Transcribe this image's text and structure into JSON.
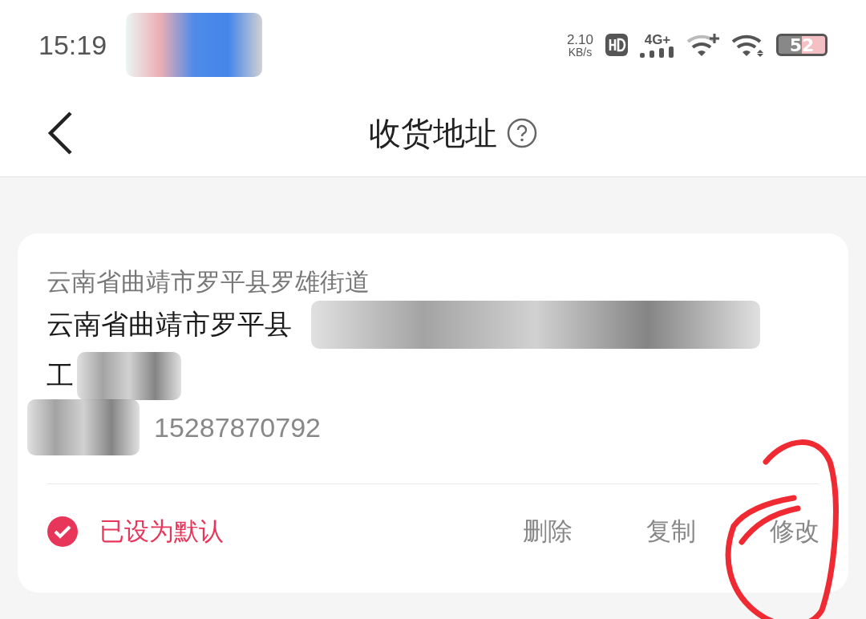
{
  "status_bar": {
    "time": "15:19",
    "speed": "2.10",
    "speed_unit": "KB/s",
    "network": "4G+",
    "battery": "52"
  },
  "header": {
    "title": "收货地址"
  },
  "address": {
    "region": "云南省曲靖市罗平县罗雄街道",
    "line_1": "云南省曲靖市罗平县",
    "line_2": "工",
    "phone": "15287870792",
    "default": true,
    "default_label": "已设为默认",
    "actions": [
      "删除",
      "复制",
      "修改"
    ]
  }
}
